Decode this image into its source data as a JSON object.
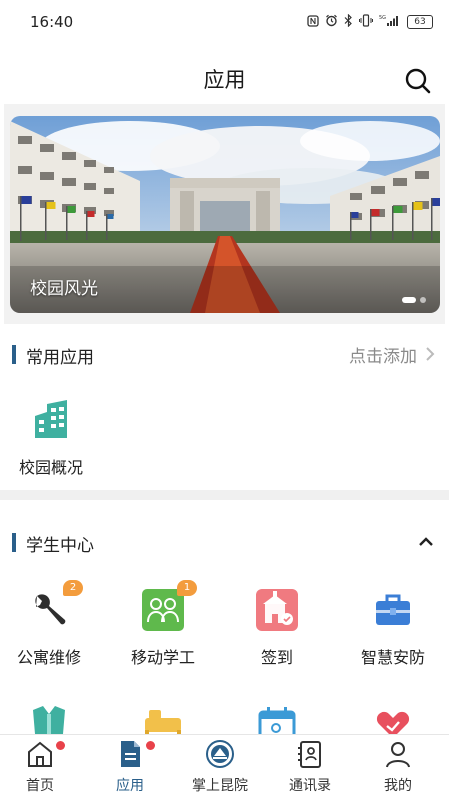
{
  "status_bar": {
    "time": "16:40",
    "battery": "63",
    "icons": [
      "nfc-icon",
      "alarm-icon",
      "bluetooth-icon",
      "vibrate-icon",
      "signal-icon"
    ]
  },
  "header": {
    "title": "应用"
  },
  "banner": {
    "caption": "校园风光",
    "slide_index": 1,
    "slide_count": 2
  },
  "common_apps": {
    "title": "常用应用",
    "add_label": "点击添加",
    "items": [
      {
        "label": "校园概况",
        "icon": "building-icon",
        "color": "#3fb0a0"
      }
    ]
  },
  "student_center": {
    "title": "学生中心",
    "items": [
      {
        "label": "公寓维修",
        "icon": "wrench-icon",
        "badge": "2",
        "color": "#333333"
      },
      {
        "label": "移动学工",
        "icon": "people-icon",
        "badge": "1",
        "color": "#5fb94c"
      },
      {
        "label": "签到",
        "icon": "signin-icon",
        "color": "#f07a80"
      },
      {
        "label": "智慧安防",
        "icon": "toolbox-icon",
        "color": "#3b7ed6"
      }
    ],
    "partial_row_icons": [
      "shirt-icon",
      "bed-icon",
      "calendar-icon",
      "heart-hand-icon"
    ]
  },
  "tabbar": {
    "tabs": [
      {
        "label": "首页",
        "icon": "home-icon",
        "dot": true
      },
      {
        "label": "应用",
        "icon": "apps-icon",
        "dot": true,
        "active": true
      },
      {
        "label": "掌上昆院",
        "icon": "college-logo-icon"
      },
      {
        "label": "通讯录",
        "icon": "contacts-icon"
      },
      {
        "label": "我的",
        "icon": "profile-icon"
      }
    ]
  },
  "colors": {
    "accent": "#2a5f8a",
    "badge": "#f39c3d",
    "dot": "#e8424a"
  }
}
